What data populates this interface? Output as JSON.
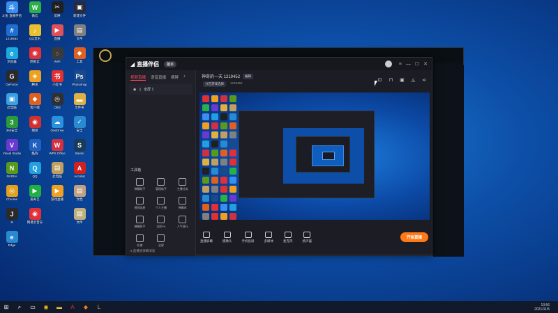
{
  "desktop": {
    "columns": [
      [
        {
          "label": "斗鱼 直播伴侣",
          "color": "#3a8ef0",
          "glyph": "斗"
        },
        {
          "label": "1219452",
          "color": "#1f6fd1",
          "glyph": "#"
        },
        {
          "label": "浏览器",
          "color": "#1ea8e0",
          "glyph": "e"
        },
        {
          "label": "GeForce",
          "color": "#2a2a2a",
          "glyph": "G"
        },
        {
          "label": "此电脑",
          "color": "#3aa0e0",
          "glyph": "▣"
        },
        {
          "label": "360安全",
          "color": "#2a9a3a",
          "glyph": "3"
        },
        {
          "label": "Visual Studio",
          "color": "#6a3ad0",
          "glyph": "V"
        },
        {
          "label": "NVIDIA",
          "color": "#5a9a1a",
          "glyph": "N"
        },
        {
          "label": "Chrome",
          "color": "#e0a020",
          "glyph": "◎"
        },
        {
          "label": "JL",
          "color": "#2a2a2a",
          "glyph": "J"
        },
        {
          "label": "Edge",
          "color": "#2a8ad0",
          "glyph": "e"
        }
      ],
      [
        {
          "label": "微信",
          "color": "#2ab048",
          "glyph": "W"
        },
        {
          "label": "QQ音乐",
          "color": "#e8c030",
          "glyph": "♪"
        },
        {
          "label": "网易云",
          "color": "#e0303a",
          "glyph": "◉"
        },
        {
          "label": "腾讯",
          "color": "#f0a020",
          "glyph": "◈"
        },
        {
          "label": "客户端",
          "color": "#e06020",
          "glyph": "◆"
        },
        {
          "label": "网易",
          "color": "#d03030",
          "glyph": "◉"
        },
        {
          "label": "酷狗",
          "color": "#2060c0",
          "glyph": "K"
        },
        {
          "label": "QQ",
          "color": "#20a0e0",
          "glyph": "Q"
        },
        {
          "label": "爱奇艺",
          "color": "#20b040",
          "glyph": "▶"
        },
        {
          "label": "网易云音乐",
          "color": "#e0303a",
          "glyph": "◉"
        }
      ],
      [
        {
          "label": "剪映",
          "color": "#202020",
          "glyph": "✂"
        },
        {
          "label": "直播",
          "color": "#e0505a",
          "glyph": "▶"
        },
        {
          "label": "WiFi",
          "color": "#3a3a3a",
          "glyph": "◌"
        },
        {
          "label": "小红书",
          "color": "#e03030",
          "glyph": "书"
        },
        {
          "label": "OBS",
          "color": "#303030",
          "glyph": "◎"
        },
        {
          "label": "OneDrive",
          "color": "#2a90e0",
          "glyph": "☁"
        },
        {
          "label": "WPS Office",
          "color": "#d03040",
          "glyph": "W"
        },
        {
          "label": "此电脑",
          "color": "#c0a060",
          "glyph": "▤"
        },
        {
          "label": "游戏直播",
          "color": "#f0a020",
          "glyph": "▶"
        }
      ],
      [
        {
          "label": "新建文件",
          "color": "#2a2a3a",
          "glyph": "▣"
        },
        {
          "label": "文件",
          "color": "#808080",
          "glyph": "▤"
        },
        {
          "label": "工具",
          "color": "#e06020",
          "glyph": "◆"
        },
        {
          "label": "Photoshop",
          "color": "#1a4a8a",
          "glyph": "Ps"
        },
        {
          "label": "文件夹",
          "color": "#e0b040",
          "glyph": "▬"
        },
        {
          "label": "安全",
          "color": "#2a8ad0",
          "glyph": "✓"
        },
        {
          "label": "Steam",
          "color": "#1a3a5a",
          "glyph": "S"
        },
        {
          "label": "Acrobat",
          "color": "#d02020",
          "glyph": "A"
        },
        {
          "label": "文档",
          "color": "#c0a080",
          "glyph": "▤"
        },
        {
          "label": "文件",
          "color": "#c0b080",
          "glyph": "▤"
        }
      ]
    ]
  },
  "app": {
    "brand": "直播伴侣",
    "version_badge": "版本",
    "tabs": [
      "视频直播",
      "语音直播",
      "横屏"
    ],
    "scene_label": "全屏 1",
    "tools_title": "工具箱",
    "tools": [
      "弹幕助手",
      "管理助手",
      "主播任务",
      "视频连麦",
      "个人主播",
      "弹幕库",
      "弹幕助手",
      "全民PK",
      "人气排行",
      "礼物",
      "全屏"
    ],
    "footer": "5.直播间弹幕消息",
    "stream_title": "神奇的一天 1219452",
    "stream_edit": "编辑",
    "stream_tag": "分区游戏选择",
    "stream_room": "1219452",
    "bottom_bar": [
      {
        "label": "直播屏幕"
      },
      {
        "label": "摄像头"
      },
      {
        "label": "手机投屏"
      },
      {
        "label": "多媒体"
      },
      {
        "label": "麦克风"
      },
      {
        "label": "扬声器"
      }
    ],
    "live_button": "开始直播"
  },
  "taskbar": {
    "time": "13:56",
    "date": "2021/11/5"
  }
}
